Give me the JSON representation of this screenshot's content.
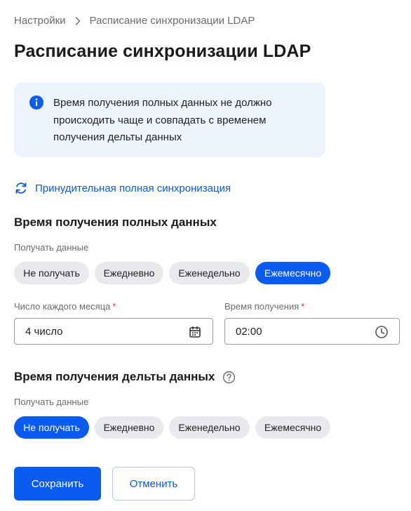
{
  "breadcrumb": {
    "parent": "Настройки",
    "current": "Расписание синхронизации LDAP"
  },
  "page_title": "Расписание синхронизации LDAP",
  "info": {
    "line1": "Время получения полных данных не должно",
    "line2": "происходить чаще и совпадать с временем",
    "line3": "получения дельты данных"
  },
  "force_sync_label": "Принудительная полная синхронизация",
  "full_data": {
    "title": "Время получения полных данных",
    "receive_label": "Получать данные",
    "options": [
      "Не получать",
      "Ежедневно",
      "Еженедельно",
      "Ежемесячно"
    ],
    "selected": "Ежемесячно",
    "day_label": "Число каждого месяца",
    "day_value": "4 число",
    "time_label": "Время получения",
    "time_value": "02:00",
    "required_mark": "*"
  },
  "delta_data": {
    "title": "Время получения дельты данных",
    "receive_label": "Получать данные",
    "options": [
      "Не получать",
      "Ежедневно",
      "Еженедельно",
      "Ежемесячно"
    ],
    "selected": "Не получать"
  },
  "actions": {
    "save": "Сохранить",
    "cancel": "Отменить"
  },
  "colors": {
    "accent": "#0a5bf2",
    "link": "#0a5bd6",
    "info_bg": "#edf4fd",
    "chip_bg": "#e9eaee",
    "required": "#d93025"
  },
  "icons": {
    "info": "info-icon",
    "sync": "sync-icon",
    "calendar": "calendar-icon",
    "clock": "clock-icon",
    "help": "help-icon",
    "chevron": "chevron-right-icon"
  }
}
